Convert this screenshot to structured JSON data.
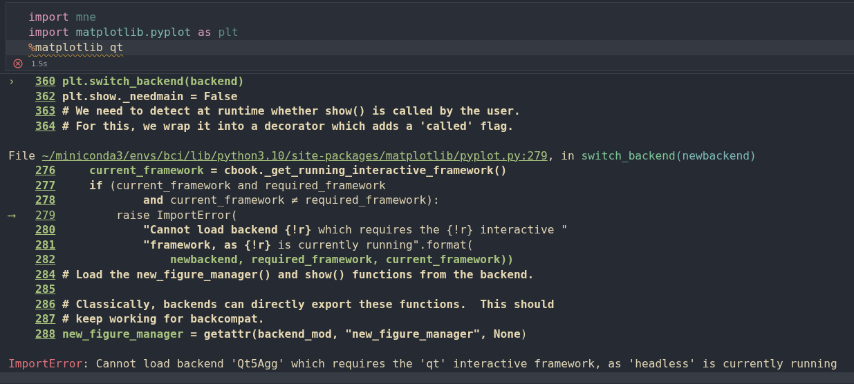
{
  "cell": {
    "lines": [
      {
        "active": false,
        "squiggle": false,
        "segments": [
          {
            "text": "import ",
            "kind": "keyword"
          },
          {
            "text": "mne",
            "kind": "dim"
          }
        ]
      },
      {
        "active": false,
        "squiggle": false,
        "segments": [
          {
            "text": "import ",
            "kind": "keyword"
          },
          {
            "text": "matplotlib.pyplot ",
            "kind": "module"
          },
          {
            "text": "as ",
            "kind": "keyword"
          },
          {
            "text": "plt",
            "kind": "dim"
          }
        ]
      },
      {
        "active": true,
        "squiggle": true,
        "segments": [
          {
            "text": "%",
            "kind": "magic"
          },
          {
            "text": "matplotlib qt",
            "kind": "plain"
          }
        ]
      }
    ],
    "status": {
      "failed": true,
      "duration": "1.5s"
    }
  },
  "output": {
    "blocks": [
      {
        "kind": "code",
        "lines": [
          {
            "number": "360",
            "marker": "›",
            "current": false,
            "segments": [
              {
                "text": "plt.switch_backend(backend)",
                "kind": "green"
              }
            ]
          },
          {
            "number": "362",
            "current": false,
            "segments": [
              {
                "text": "plt.show._needmain = False",
                "kind": "bold"
              }
            ]
          },
          {
            "number": "363",
            "current": false,
            "segments": [
              {
                "text": "# We need to detect at runtime whether show() is called by the user.",
                "kind": "bold"
              }
            ]
          },
          {
            "number": "364",
            "current": false,
            "segments": [
              {
                "text": "# For this, we wrap it into a decorator which adds a 'called' flag.",
                "kind": "bold"
              }
            ]
          }
        ]
      },
      {
        "kind": "location",
        "segments": [
          {
            "text": "File ",
            "kind": "plain"
          },
          {
            "text": "~/miniconda3/envs/bci/lib/python3.10/site-packages/matplotlib/pyplot.py:279",
            "kind": "link"
          },
          {
            "text": ", in ",
            "kind": "plain"
          },
          {
            "text": "switch_backend",
            "kind": "func"
          },
          {
            "text": "(newbackend)",
            "kind": "param"
          }
        ]
      },
      {
        "kind": "code",
        "lines": [
          {
            "number": "276",
            "current": false,
            "segments": [
              {
                "text": "    current_framework",
                "kind": "green"
              },
              {
                "text": " = cbook._get_running_interactive_framework()",
                "kind": "bold"
              }
            ]
          },
          {
            "number": "277",
            "current": false,
            "segments": [
              {
                "text": "    if",
                "kind": "bold"
              },
              {
                "text": " (current_framework and required_framework",
                "kind": "plain"
              }
            ]
          },
          {
            "number": "278",
            "current": false,
            "segments": [
              {
                "text": "            and",
                "kind": "bold"
              },
              {
                "text": " current_framework ≠ required_framework):",
                "kind": "plain"
              }
            ]
          },
          {
            "number": "279",
            "marker": "⟶",
            "current": true,
            "segments": [
              {
                "text": "        raise ImportError(",
                "kind": "plain"
              }
            ]
          },
          {
            "number": "280",
            "current": false,
            "segments": [
              {
                "text": "            \"Cannot load backend {!r}",
                "kind": "bold"
              },
              {
                "text": " which requires the {!r} interactive \"",
                "kind": "plain"
              }
            ]
          },
          {
            "number": "281",
            "current": false,
            "segments": [
              {
                "text": "            \"framework, as {!r}",
                "kind": "bold"
              },
              {
                "text": " is currently running\".format(",
                "kind": "plain"
              }
            ]
          },
          {
            "number": "282",
            "current": false,
            "segments": [
              {
                "text": "                newbackend, required_framework, current_framework))",
                "kind": "green"
              }
            ]
          },
          {
            "number": "284",
            "current": false,
            "segments": [
              {
                "text": "# Load the new_figure_manager() and show() functions from the backend.",
                "kind": "bold"
              }
            ]
          },
          {
            "number": "285",
            "current": false
          },
          {
            "number": "286",
            "current": false,
            "segments": [
              {
                "text": "# Classically, backends can directly export these functions.  This should",
                "kind": "bold"
              }
            ]
          },
          {
            "number": "287",
            "current": false,
            "segments": [
              {
                "text": "# keep working for backcompat.",
                "kind": "bold"
              }
            ]
          },
          {
            "number": "288",
            "current": false,
            "segments": [
              {
                "text": "new_figure_manager",
                "kind": "green"
              },
              {
                "text": " = getattr(backend_mod, \"new_figure_manager\", None",
                "kind": "bold"
              },
              {
                "text": ")",
                "kind": "plain"
              }
            ]
          }
        ]
      },
      {
        "kind": "error",
        "segments": [
          {
            "text": "ImportError",
            "kind": "error"
          },
          {
            "text": ": Cannot load backend 'Qt5Agg' which requires the 'qt' interactive framework, as 'headless' is currently running",
            "kind": "plain"
          }
        ]
      }
    ]
  }
}
